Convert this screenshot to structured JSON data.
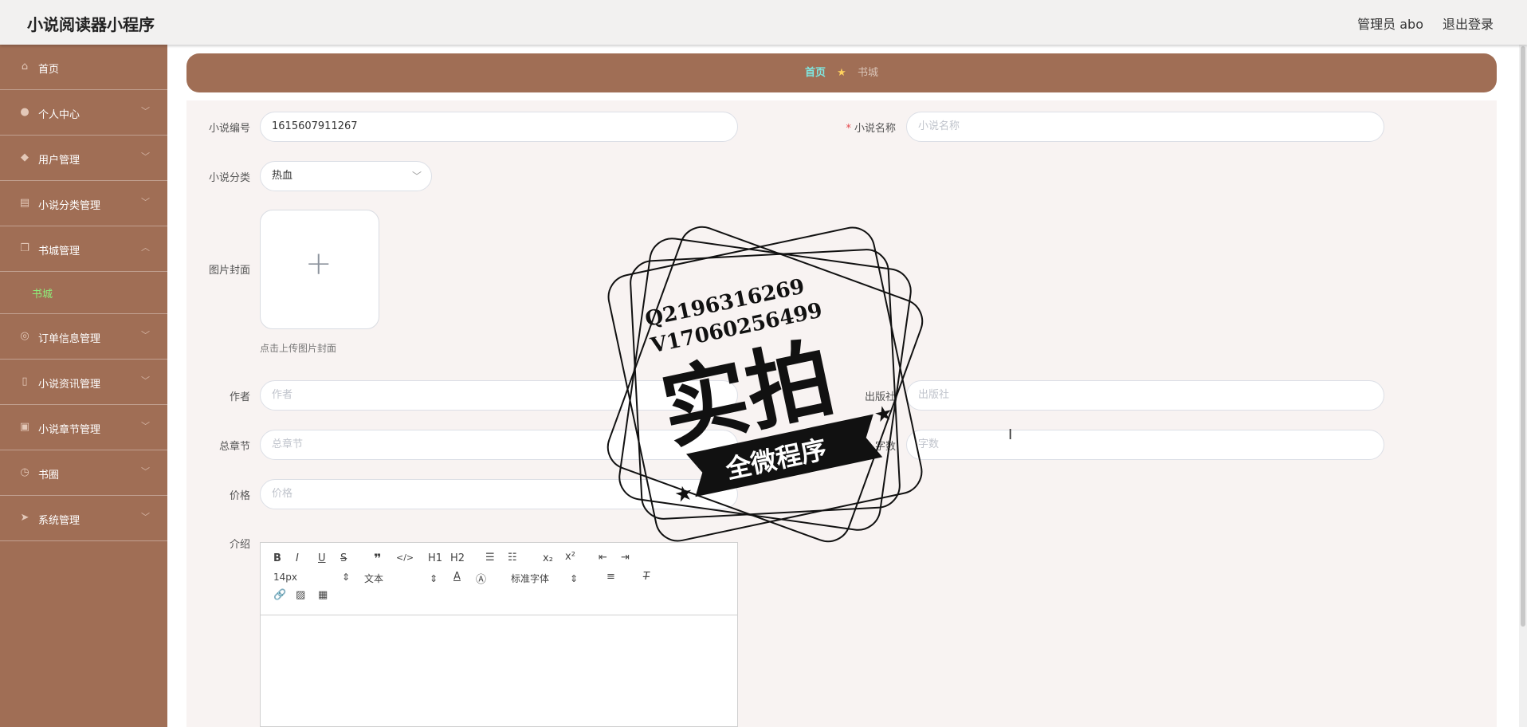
{
  "header": {
    "title": "小说阅读器小程序",
    "admin": "管理员 abo",
    "logout": "退出登录"
  },
  "sidebar": {
    "items": [
      {
        "label": "首页",
        "icon": "home-icon"
      },
      {
        "label": "个人中心",
        "icon": "user-icon"
      },
      {
        "label": "用户管理",
        "icon": "shield-icon"
      },
      {
        "label": "小说分类管理",
        "icon": "briefcase-icon"
      },
      {
        "label": "书城管理",
        "icon": "copy-icon",
        "expanded": true,
        "sub": "书城"
      },
      {
        "label": "订单信息管理",
        "icon": "compass-icon"
      },
      {
        "label": "小说资讯管理",
        "icon": "mobile-icon"
      },
      {
        "label": "小说章节管理",
        "icon": "checklist-icon"
      },
      {
        "label": "书圈",
        "icon": "clock-icon"
      },
      {
        "label": "系统管理",
        "icon": "send-icon"
      }
    ],
    "sub_active": "书城"
  },
  "breadcrumb": {
    "home": "首页",
    "current": "书城"
  },
  "form": {
    "id_label": "小说编号",
    "id_value": "1615607911267",
    "name_label": "小说名称",
    "name_placeholder": "小说名称",
    "category_label": "小说分类",
    "category_value": "热血",
    "cover_label": "图片封面",
    "cover_tip": "点击上传图片封面",
    "author_label": "作者",
    "author_placeholder": "作者",
    "publisher_label": "出版社",
    "publisher_placeholder": "出版社",
    "chapters_label": "总章节",
    "chapters_placeholder": "总章节",
    "words_label": "字数",
    "words_placeholder": "字数",
    "price_label": "价格",
    "price_placeholder": "价格",
    "intro_label": "介绍"
  },
  "editor": {
    "font_size": "14px",
    "text_type": "文本",
    "font_family": "标准字体",
    "buttons": {
      "h1": "H1",
      "h2": "H2",
      "sub": "x₂",
      "sup": "x²",
      "bold": "B",
      "italic": "I",
      "underline": "U",
      "strike": "S"
    }
  },
  "stamp": {
    "line1": "Q2196316269",
    "line2": "V17060256499",
    "main": "实拍",
    "ribbon": "全微程序"
  },
  "colors": {
    "sidebar": "#a06e55",
    "active_sub": "#8ef07b",
    "crumb_home": "#7fe7e0",
    "form_bg": "#f8f3f2"
  }
}
